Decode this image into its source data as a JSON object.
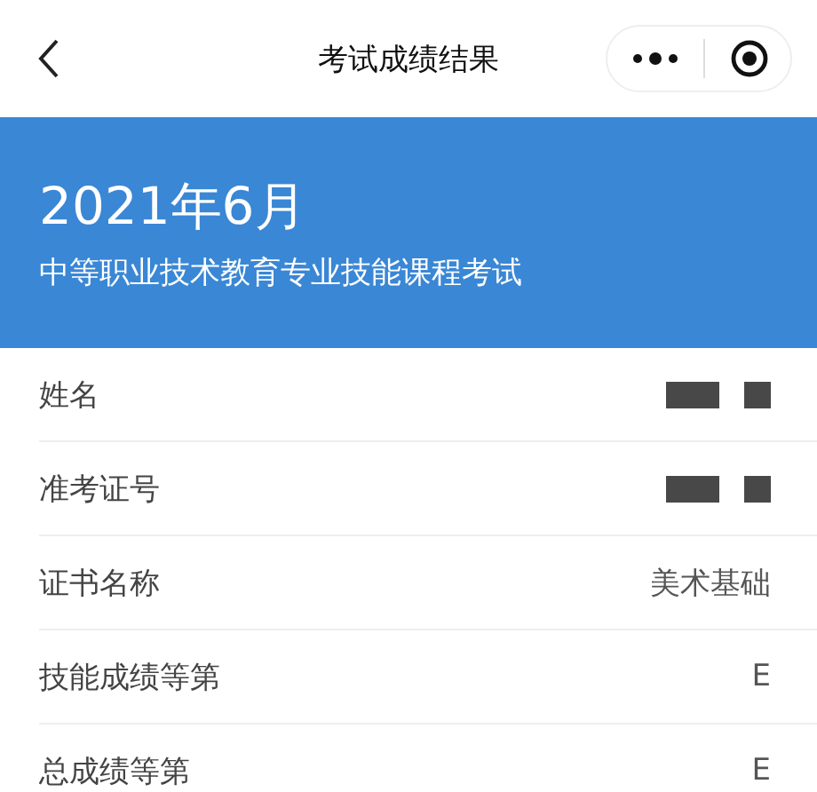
{
  "nav": {
    "title": "考试成绩结果"
  },
  "banner": {
    "date": "2021年6月",
    "exam": "中等职业技术教育专业技能课程考试"
  },
  "rows": [
    {
      "label": "姓名",
      "kind": "redacted"
    },
    {
      "label": "准考证号",
      "kind": "redacted"
    },
    {
      "label": "证书名称",
      "kind": "text",
      "value": "美术基础"
    },
    {
      "label": "技能成绩等第",
      "kind": "text",
      "value": "E"
    },
    {
      "label": "总成绩等第",
      "kind": "text",
      "value": "E"
    }
  ]
}
